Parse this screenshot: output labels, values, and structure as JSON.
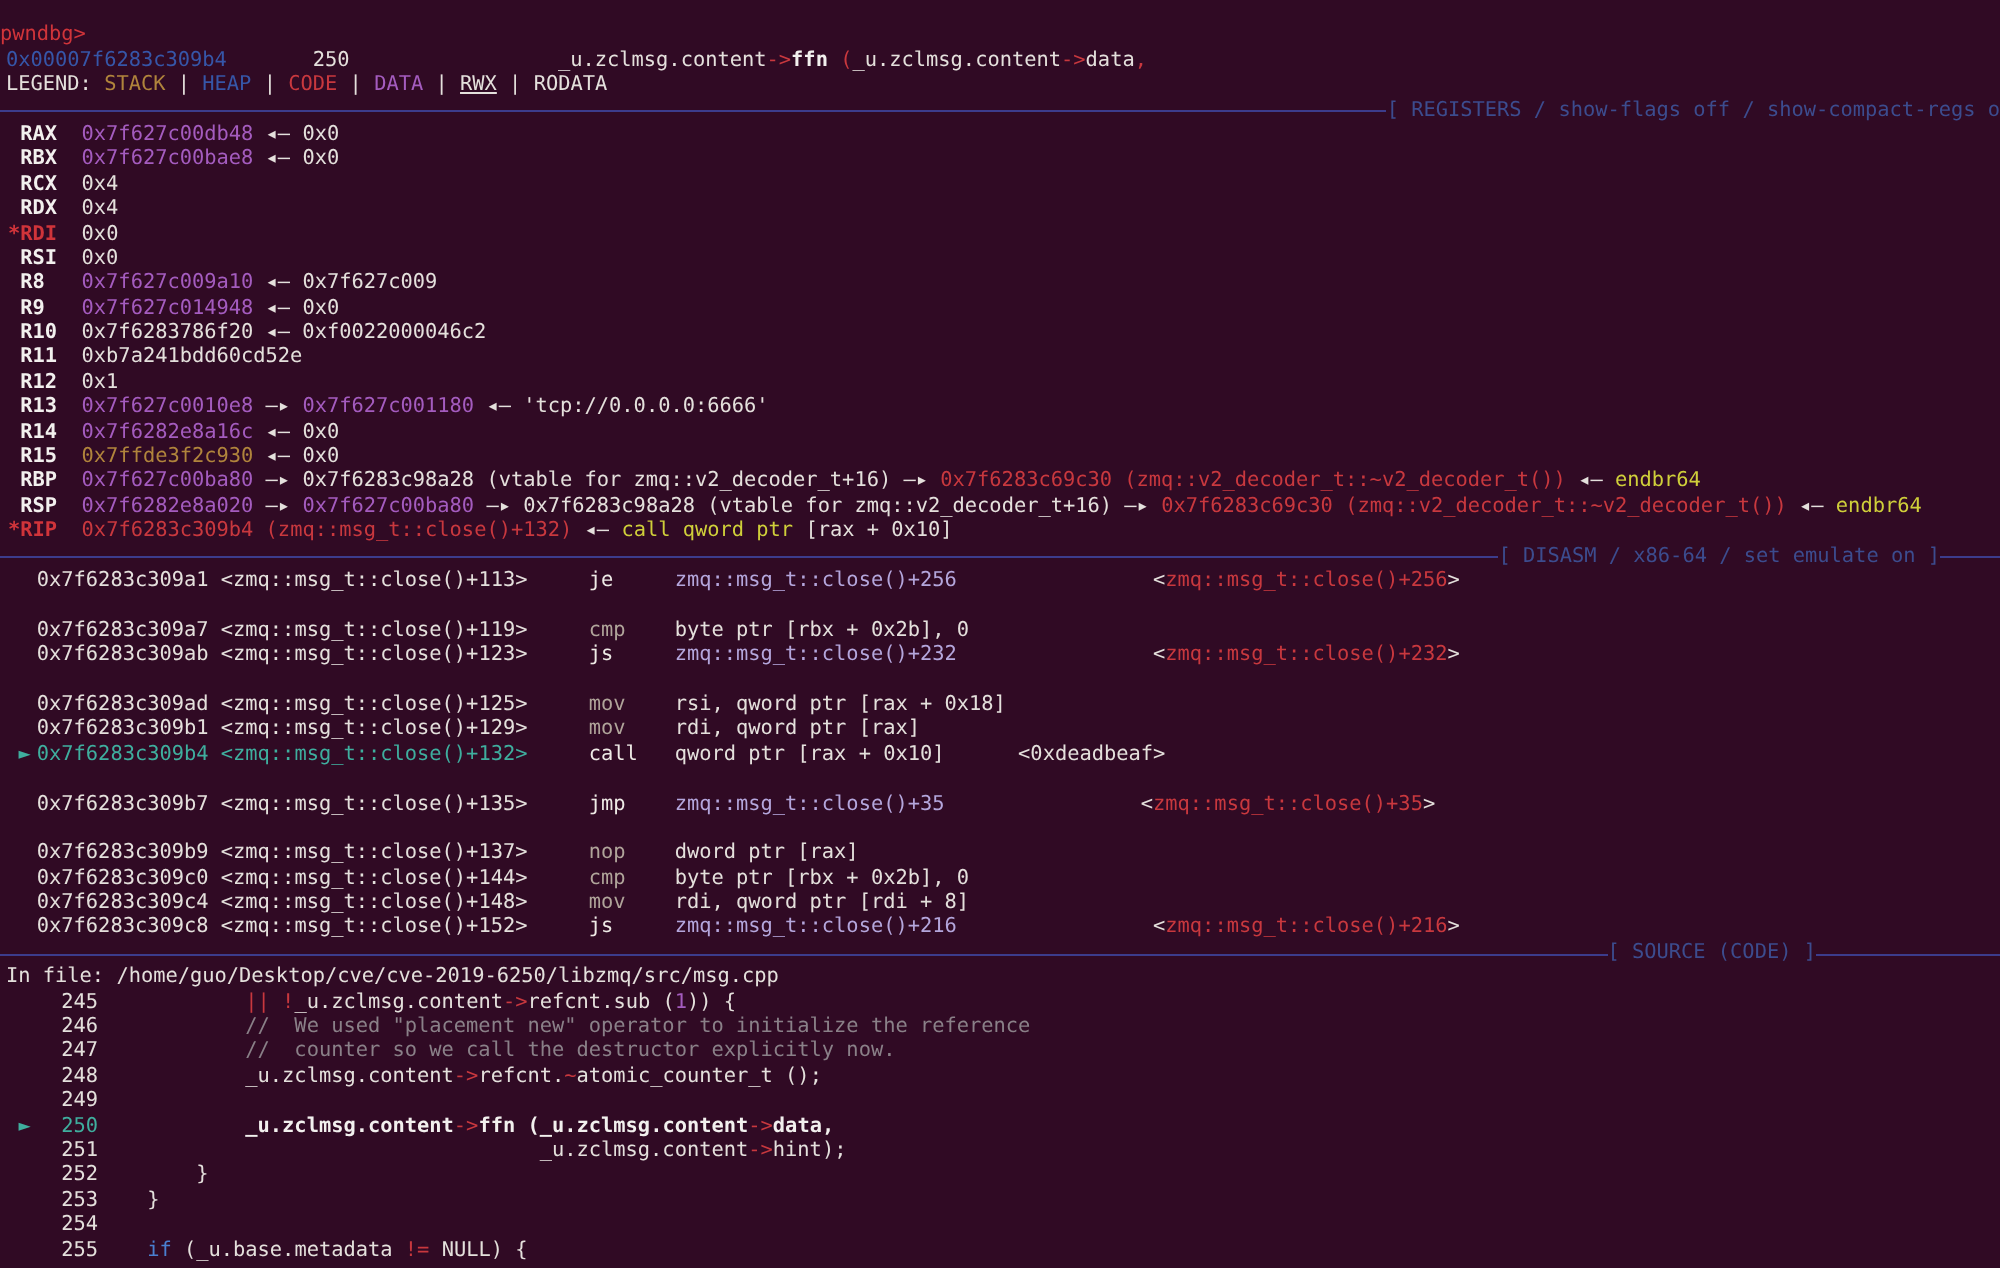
{
  "prompt": "pwndbg>",
  "context_line": {
    "address": "0x00007f6283c309b4",
    "line": "250",
    "code": [
      {
        "text": "_u.zclmsg.content",
        "kind": "plain"
      },
      {
        "text": "->",
        "kind": "op"
      },
      {
        "text": "ffn",
        "kind": "bold"
      },
      {
        "text": " (",
        "kind": "op"
      },
      {
        "text": "_u.zclmsg.content",
        "kind": "plain"
      },
      {
        "text": "->",
        "kind": "op"
      },
      {
        "text": "data",
        "kind": "plain"
      },
      {
        "text": ",",
        "kind": "op"
      }
    ]
  },
  "legend": [
    {
      "text": "LEGEND: ",
      "kind": "plain"
    },
    {
      "text": "STACK",
      "kind": "stack"
    },
    {
      "text": " | ",
      "kind": "plain"
    },
    {
      "text": "HEAP",
      "kind": "heap"
    },
    {
      "text": " | ",
      "kind": "plain"
    },
    {
      "text": "CODE",
      "kind": "code"
    },
    {
      "text": " | ",
      "kind": "plain"
    },
    {
      "text": "DATA",
      "kind": "data"
    },
    {
      "text": " | ",
      "kind": "plain"
    },
    {
      "text": "RWX",
      "kind": "rwx"
    },
    {
      "text": " | RODATA",
      "kind": "plain"
    }
  ],
  "registers": {
    "title": "[ REGISTERS / show-flags off / show-compact-regs o",
    "rows": [
      {
        "name": "RAX",
        "modified": false,
        "value": [
          {
            "text": "0x7f627c00db48",
            "kind": "data"
          },
          {
            "text": " ◂— 0x0",
            "kind": "plain"
          }
        ]
      },
      {
        "name": "RBX",
        "modified": false,
        "value": [
          {
            "text": "0x7f627c00bae8",
            "kind": "data"
          },
          {
            "text": " ◂— 0x0",
            "kind": "plain"
          }
        ]
      },
      {
        "name": "RCX",
        "modified": false,
        "value": [
          {
            "text": "0x4",
            "kind": "plain"
          }
        ]
      },
      {
        "name": "RDX",
        "modified": false,
        "value": [
          {
            "text": "0x4",
            "kind": "plain"
          }
        ]
      },
      {
        "marker": "*",
        "name": "RDI",
        "modified": true,
        "value": [
          {
            "text": "0x0",
            "kind": "plain"
          }
        ]
      },
      {
        "name": "RSI",
        "modified": false,
        "value": [
          {
            "text": "0x0",
            "kind": "plain"
          }
        ]
      },
      {
        "name": "R8",
        "modified": false,
        "value": [
          {
            "text": "0x7f627c009a10",
            "kind": "data"
          },
          {
            "text": " ◂— 0x7f627c009",
            "kind": "plain"
          }
        ]
      },
      {
        "name": "R9",
        "modified": false,
        "value": [
          {
            "text": "0x7f627c014948",
            "kind": "data"
          },
          {
            "text": " ◂— 0x0",
            "kind": "plain"
          }
        ]
      },
      {
        "name": "R10",
        "modified": false,
        "value": [
          {
            "text": "0x7f6283786f20 ◂— 0xf0022000046c2",
            "kind": "plain"
          }
        ]
      },
      {
        "name": "R11",
        "modified": false,
        "value": [
          {
            "text": "0xb7a241bdd60cd52e",
            "kind": "plain"
          }
        ]
      },
      {
        "name": "R12",
        "modified": false,
        "value": [
          {
            "text": "0x1",
            "kind": "plain"
          }
        ]
      },
      {
        "name": "R13",
        "modified": false,
        "value": [
          {
            "text": "0x7f627c0010e8",
            "kind": "data"
          },
          {
            "text": " —▸ ",
            "kind": "plain"
          },
          {
            "text": "0x7f627c001180",
            "kind": "data"
          },
          {
            "text": " ◂— 'tcp://0.0.0.0:6666'",
            "kind": "plain"
          }
        ]
      },
      {
        "name": "R14",
        "modified": false,
        "value": [
          {
            "text": "0x7f6282e8a16c",
            "kind": "data"
          },
          {
            "text": " ◂— 0x0",
            "kind": "plain"
          }
        ]
      },
      {
        "name": "R15",
        "modified": false,
        "value": [
          {
            "text": "0x7ffde3f2c930",
            "kind": "stack"
          },
          {
            "text": " ◂— 0x0",
            "kind": "plain"
          }
        ]
      },
      {
        "name": "RBP",
        "modified": false,
        "value": [
          {
            "text": "0x7f627c00ba80",
            "kind": "data"
          },
          {
            "text": " —▸ 0x7f6283c98a28 (vtable for zmq::v2_decoder_t+16) —▸ ",
            "kind": "plain"
          },
          {
            "text": "0x7f6283c69c30 (zmq::v2_decoder_t::~v2_decoder_t())",
            "kind": "code"
          },
          {
            "text": " ◂— ",
            "kind": "plain"
          },
          {
            "text": "endbr64",
            "kind": "insn"
          }
        ]
      },
      {
        "name": "RSP",
        "modified": false,
        "value": [
          {
            "text": "0x7f6282e8a020",
            "kind": "data"
          },
          {
            "text": " —▸ ",
            "kind": "plain"
          },
          {
            "text": "0x7f627c00ba80",
            "kind": "data"
          },
          {
            "text": " —▸ 0x7f6283c98a28 (vtable for zmq::v2_decoder_t+16) —▸ ",
            "kind": "plain"
          },
          {
            "text": "0x7f6283c69c30 (zmq::v2_decoder_t::~v2_decoder_t())",
            "kind": "code"
          },
          {
            "text": " ◂— ",
            "kind": "plain"
          },
          {
            "text": "endbr64",
            "kind": "insn"
          }
        ]
      },
      {
        "marker": "*",
        "name": "RIP",
        "modified": true,
        "value": [
          {
            "text": "0x7f6283c309b4 (zmq::msg_t::close()+132)",
            "kind": "code"
          },
          {
            "text": " ◂— ",
            "kind": "plain"
          },
          {
            "text": "call qword ptr ",
            "kind": "insn"
          },
          {
            "text": "[rax + 0x10]",
            "kind": "plain"
          }
        ]
      }
    ]
  },
  "disasm": {
    "title": "[ DISASM / x86-64 / set emulate on ]",
    "rows": [
      {
        "address": "0x7f6283c309a1",
        "symbol": "<zmq::msg_t::close()+113>",
        "current": false,
        "spaced": false,
        "mnemonic": {
          "text": "je",
          "kind": "branch"
        },
        "operands": {
          "text": "zmq::msg_t::close()+256",
          "kind": "target"
        },
        "comment": [
          {
            "text": "<",
            "kind": "plain"
          },
          {
            "text": "zmq::msg_t::close()+256",
            "kind": "code"
          },
          {
            "text": ">",
            "kind": "plain"
          }
        ]
      },
      {
        "address": "0x7f6283c309a7",
        "symbol": "<zmq::msg_t::close()+119>",
        "current": false,
        "spaced": true,
        "mnemonic": {
          "text": "cmp",
          "kind": "other"
        },
        "operands": {
          "text": "byte ptr [rbx + 0x2b], 0",
          "kind": "plain"
        }
      },
      {
        "address": "0x7f6283c309ab",
        "symbol": "<zmq::msg_t::close()+123>",
        "current": false,
        "spaced": false,
        "mnemonic": {
          "text": "js",
          "kind": "branch"
        },
        "operands": {
          "text": "zmq::msg_t::close()+232",
          "kind": "target"
        },
        "comment": [
          {
            "text": "<",
            "kind": "plain"
          },
          {
            "text": "zmq::msg_t::close()+232",
            "kind": "code"
          },
          {
            "text": ">",
            "kind": "plain"
          }
        ]
      },
      {
        "address": "0x7f6283c309ad",
        "symbol": "<zmq::msg_t::close()+125>",
        "current": false,
        "spaced": true,
        "mnemonic": {
          "text": "mov",
          "kind": "other"
        },
        "operands": {
          "text": "rsi, qword ptr [rax + 0x18]",
          "kind": "plain"
        }
      },
      {
        "address": "0x7f6283c309b1",
        "symbol": "<zmq::msg_t::close()+129>",
        "current": false,
        "spaced": false,
        "mnemonic": {
          "text": "mov",
          "kind": "other"
        },
        "operands": {
          "text": "rdi, qword ptr [rax]",
          "kind": "plain"
        }
      },
      {
        "marker": "►",
        "address": "0x7f6283c309b4",
        "symbol": "<zmq::msg_t::close()+132>",
        "current": true,
        "spaced": false,
        "mnemonic": {
          "text": "call",
          "kind": "branch"
        },
        "operands": {
          "text": "qword ptr [rax + 0x10]",
          "kind": "plain"
        },
        "comment": [
          {
            "text": "<0xdeadbeaf>",
            "kind": "plain"
          }
        ]
      },
      {
        "address": "0x7f6283c309b7",
        "symbol": "<zmq::msg_t::close()+135>",
        "current": false,
        "spaced": true,
        "mnemonic": {
          "text": "jmp",
          "kind": "branch"
        },
        "operands": {
          "text": "zmq::msg_t::close()+35",
          "kind": "target"
        },
        "comment": [
          {
            "text": "<",
            "kind": "plain"
          },
          {
            "text": "zmq::msg_t::close()+35",
            "kind": "code"
          },
          {
            "text": ">",
            "kind": "plain"
          }
        ]
      },
      {
        "address": "0x7f6283c309b9",
        "symbol": "<zmq::msg_t::close()+137>",
        "current": false,
        "spaced": true,
        "mnemonic": {
          "text": "nop",
          "kind": "other"
        },
        "operands": {
          "text": "dword ptr [rax]",
          "kind": "plain"
        }
      },
      {
        "address": "0x7f6283c309c0",
        "symbol": "<zmq::msg_t::close()+144>",
        "current": false,
        "spaced": false,
        "mnemonic": {
          "text": "cmp",
          "kind": "other"
        },
        "operands": {
          "text": "byte ptr [rbx + 0x2b], 0",
          "kind": "plain"
        }
      },
      {
        "address": "0x7f6283c309c4",
        "symbol": "<zmq::msg_t::close()+148>",
        "current": false,
        "spaced": false,
        "mnemonic": {
          "text": "mov",
          "kind": "other"
        },
        "operands": {
          "text": "rdi, qword ptr [rdi + 8]",
          "kind": "plain"
        }
      },
      {
        "address": "0x7f6283c309c8",
        "symbol": "<zmq::msg_t::close()+152>",
        "current": false,
        "spaced": false,
        "mnemonic": {
          "text": "js",
          "kind": "branch"
        },
        "operands": {
          "text": "zmq::msg_t::close()+216",
          "kind": "target"
        },
        "comment": [
          {
            "text": "<",
            "kind": "plain"
          },
          {
            "text": "zmq::msg_t::close()+216",
            "kind": "code"
          },
          {
            "text": ">",
            "kind": "plain"
          }
        ]
      }
    ]
  },
  "source": {
    "title": "[ SOURCE (CODE) ]",
    "file": "In file: /home/guo/Desktop/cve/cve-2019-6250/libzmq/src/msg.cpp",
    "lines": [
      {
        "number": "245",
        "current": false,
        "code": [
          {
            "text": "            ||",
            "kind": "op"
          },
          {
            "text": " !",
            "kind": "op"
          },
          {
            "text": "_u.zclmsg.content",
            "kind": "plain"
          },
          {
            "text": "->",
            "kind": "op"
          },
          {
            "text": "refcnt.sub (",
            "kind": "plain"
          },
          {
            "text": "1",
            "kind": "num"
          },
          {
            "text": ")) {",
            "kind": "plain"
          }
        ]
      },
      {
        "number": "246",
        "current": false,
        "code": [
          {
            "text": "            //  We used \"placement new\" operator to initialize the reference",
            "kind": "comment"
          }
        ]
      },
      {
        "number": "247",
        "current": false,
        "code": [
          {
            "text": "            //  counter so we call the destructor explicitly now.",
            "kind": "comment"
          }
        ]
      },
      {
        "number": "248",
        "current": false,
        "code": [
          {
            "text": "            _u.zclmsg.content",
            "kind": "plain"
          },
          {
            "text": "->",
            "kind": "op"
          },
          {
            "text": "refcnt.",
            "kind": "plain"
          },
          {
            "text": "~",
            "kind": "op"
          },
          {
            "text": "atomic_counter_t ();",
            "kind": "plain"
          }
        ]
      },
      {
        "number": "249",
        "current": false
      },
      {
        "marker": "►",
        "number": "250",
        "current": true,
        "code": [
          {
            "text": "            _u.zclmsg.content",
            "kind": "bold"
          },
          {
            "text": "->",
            "kind": "op"
          },
          {
            "text": "ffn (_u.zclmsg.content",
            "kind": "bold"
          },
          {
            "text": "->",
            "kind": "op"
          },
          {
            "text": "data,",
            "kind": "bold"
          }
        ]
      },
      {
        "number": "251",
        "current": false,
        "code": [
          {
            "text": "                                    _u.zclmsg.content",
            "kind": "plain"
          },
          {
            "text": "->",
            "kind": "op"
          },
          {
            "text": "hint);",
            "kind": "plain"
          }
        ]
      },
      {
        "number": "252",
        "current": false,
        "code": [
          {
            "text": "        }",
            "kind": "plain"
          }
        ]
      },
      {
        "number": "253",
        "current": false,
        "code": [
          {
            "text": "    }",
            "kind": "plain"
          }
        ]
      },
      {
        "number": "254",
        "current": false
      },
      {
        "number": "255",
        "current": false,
        "code": [
          {
            "text": "    if",
            "kind": "keyword"
          },
          {
            "text": " (_u.base.metadata ",
            "kind": "plain"
          },
          {
            "text": "!=",
            "kind": "op"
          },
          {
            "text": " NULL) {",
            "kind": "plain"
          }
        ]
      }
    ]
  }
}
